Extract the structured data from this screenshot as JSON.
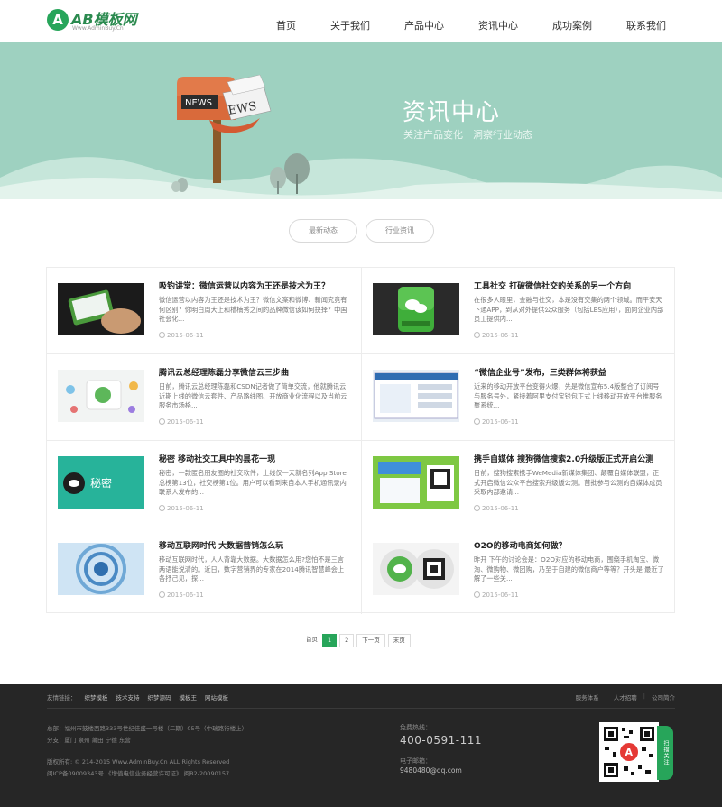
{
  "header": {
    "logo_mark": "A",
    "logo_name": "AB模板网",
    "logo_url": "Www.AdminBuy.Cn",
    "nav": [
      "首页",
      "关于我们",
      "产品中心",
      "资讯中心",
      "成功案例",
      "联系我们"
    ]
  },
  "banner": {
    "title": "资讯中心",
    "subtitle": "关注产品变化　洞察行业动态",
    "sign_front": "NEWS",
    "sign_back": "EWS"
  },
  "filters": [
    "最新动态",
    "行业资讯"
  ],
  "news": [
    {
      "title": "吸钓讲堂：微信运营以内容为王还是技术为王？",
      "desc": "微信运营以内容为王还是技术为王？微信文案和微博、新闻究竟有何区别？你明白周大上和槽楠秀之间的品牌微信该如何抉择？中国社会化...",
      "date": "2015-06-11",
      "thumb": "phone-icon"
    },
    {
      "title": "工具社交 打破微信社交的关系的另一个方向",
      "desc": "在很多人眼里，金融与社交，本是没有交集的两个领域。而平安天下通APP，到从对外提供公众服务（包括LBS应用），面向企业内部员工提供内...",
      "date": "2015-06-11",
      "thumb": "wechat-icon"
    },
    {
      "title": "腾讯云总经理陈磊分享微信云三步曲",
      "desc": "日前，腾讯云总经理陈磊和CSDN记者做了简单交流，他就腾讯云近期上线的微信云套件、产品路线图、开放商业化流程以及当前云服务市场格...",
      "date": "2015-06-11",
      "thumb": "cloud-icon"
    },
    {
      "title": "“微信企业号”发布，三类群体将获益",
      "desc": "近来的移动开放平台变得火爆，先是微信宣布5.4版整合了订阅号与服务号外，紧接着阿里支付宝钱包正式上线移动开放平台推服务聚系统...",
      "date": "2015-06-11",
      "thumb": "screen-icon"
    },
    {
      "title": "秘密 移动社交工具中的昙花一现",
      "desc": "秘密，一款匿名朋友圈的社交软件，上线仅一天就名列App Store总榜第13位，社交榜第1位。用户可以看到来自本人手机通讯录内联系人发布的...",
      "date": "2015-06-11",
      "thumb": "secret-icon"
    },
    {
      "title": "携手自媒体 搜狗微信搜索2.0升级版正式开启公测",
      "desc": "日前，搜狗搜索携手WeMedia新媒体集团、颠覆自媒体联盟，正式开启微信公众平台搜索升级版公测。首批参与公测的自媒体成员采取内部邀请...",
      "date": "2015-06-11",
      "thumb": "sogou-icon"
    },
    {
      "title": "移动互联网时代 大数据营销怎么玩",
      "desc": "移动互联网时代，人人背靠大数据。大数据怎么用?您怕不是三言两语能说清的。近日，数字营销界的专家在2014腾讯智慧峰会上各抒己见，探...",
      "date": "2015-06-11",
      "thumb": "bigdata-icon"
    },
    {
      "title": "O2O的移动电商如何做？",
      "desc": "昨开 下午的讨论会是：O2O对应的移动电商，围绕手机淘宝、微淘、微购物、微团购，乃至于自建的微信商户等等？开头是 最近了解了一些关...",
      "date": "2015-06-11",
      "thumb": "o2o-icon"
    }
  ],
  "pager": {
    "first": "首页",
    "pages": [
      "1",
      "2"
    ],
    "next": "下一页",
    "last": "末页"
  },
  "footer": {
    "links_label": "友情链接：",
    "links": [
      "织梦模板",
      "技术支持",
      "织梦源码",
      "模板王",
      "网站模板"
    ],
    "right_links": [
      "服务体系",
      "人才招聘",
      "公司简介"
    ],
    "address": "总部：福州市鼓楼西路333号世纪佳盛一号楼（二期）05号（中瑞路行楼上）",
    "branches": "分支：厦门 泉州 莆田 宁德 东营",
    "copyright": "版权所有: © 214-2015 Www.AdminBuy.Cn ALL Rights Reserved",
    "icp": "闽ICP备09009343号 《增值电信业务经营许可证》 闽B2-20090157",
    "hotline_label": "免费热线：",
    "hotline": "400-0591-111",
    "mail_label": "电子邮箱：",
    "mail": "9480480@qq.com",
    "qr_tab": "扫描关注"
  },
  "colors": {
    "brand_green": "#27a55a",
    "banner_bg": "#9ed1c0",
    "footer_bg": "#262626"
  }
}
